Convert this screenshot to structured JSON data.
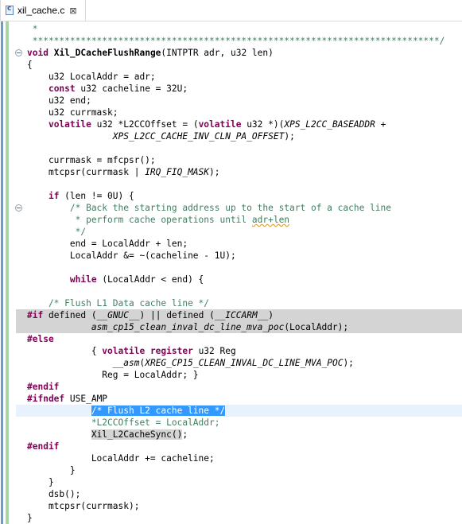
{
  "tab": {
    "filename": "xil_cache.c",
    "close_symbol": "⊠"
  },
  "code_lines": [
    " *",
    " ****************************************************************************/",
    "void Xil_DCacheFlushRange(INTPTR adr, u32 len)",
    "{",
    "    u32 LocalAddr = adr;",
    "    const u32 cacheline = 32U;",
    "    u32 end;",
    "    u32 currmask;",
    "    volatile u32 *L2CCOffset = (volatile u32 *)(XPS_L2CC_BASEADDR +",
    "                XPS_L2CC_CACHE_INV_CLN_PA_OFFSET);",
    "",
    "    currmask = mfcpsr();",
    "    mtcpsr(currmask | IRQ_FIQ_MASK);",
    "",
    "    if (len != 0U) {",
    "        /* Back the starting address up to the start of a cache line",
    "         * perform cache operations until adr+len",
    "         */",
    "        end = LocalAddr + len;",
    "        LocalAddr &= ~(cacheline - 1U);",
    "",
    "        while (LocalAddr < end) {",
    "",
    "    /* Flush L1 Data cache line */",
    "#if defined (__GNUC__) || defined (__ICCARM__)",
    "            asm_cp15_clean_inval_dc_line_mva_poc(LocalAddr);",
    "#else",
    "            { volatile register u32 Reg",
    "                __asm(XREG_CP15_CLEAN_INVAL_DC_LINE_MVA_POC);",
    "              Reg = LocalAddr; }",
    "#endif",
    "#ifndef USE_AMP",
    "            /* Flush L2 cache line */",
    "            *L2CCOffset = LocalAddr;",
    "            Xil_L2CacheSync();",
    "#endif",
    "            LocalAddr += cacheline;",
    "        }",
    "    }",
    "    dsb();",
    "    mtcpsr(currmask);",
    "}"
  ]
}
